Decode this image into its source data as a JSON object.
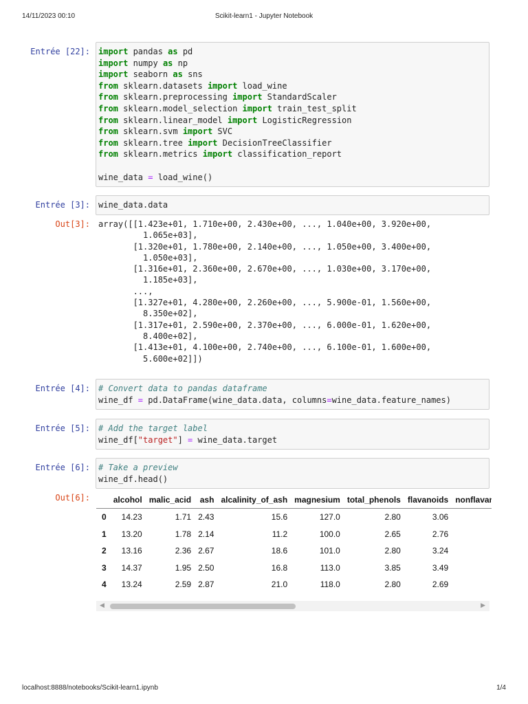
{
  "header": {
    "datetime": "14/11/2023 00:10",
    "title": "Scikit-learn1 - Jupyter Notebook"
  },
  "footer": {
    "url": "localhost:8888/notebooks/Scikit-learn1.ipynb",
    "page": "1/4"
  },
  "cells": [
    {
      "prompt": "Entrée [22]:",
      "lines": [
        [
          [
            "import",
            "kw"
          ],
          [
            " pandas ",
            ""
          ],
          [
            "as",
            "kw"
          ],
          [
            " pd",
            ""
          ]
        ],
        [
          [
            "import",
            "kw"
          ],
          [
            " numpy ",
            ""
          ],
          [
            "as",
            "kw"
          ],
          [
            " np",
            ""
          ]
        ],
        [
          [
            "import",
            "kw"
          ],
          [
            " seaborn ",
            ""
          ],
          [
            "as",
            "kw"
          ],
          [
            " sns",
            ""
          ]
        ],
        [
          [
            "from",
            "kw"
          ],
          [
            " sklearn.datasets ",
            ""
          ],
          [
            "import",
            "kw"
          ],
          [
            " load_wine",
            ""
          ]
        ],
        [
          [
            "from",
            "kw"
          ],
          [
            " sklearn.preprocessing ",
            ""
          ],
          [
            "import",
            "kw"
          ],
          [
            " StandardScaler",
            ""
          ]
        ],
        [
          [
            "from",
            "kw"
          ],
          [
            " sklearn.model_selection ",
            ""
          ],
          [
            "import",
            "kw"
          ],
          [
            " train_test_split",
            ""
          ]
        ],
        [
          [
            "from",
            "kw"
          ],
          [
            " sklearn.linear_model ",
            ""
          ],
          [
            "import",
            "kw"
          ],
          [
            " LogisticRegression",
            ""
          ]
        ],
        [
          [
            "from",
            "kw"
          ],
          [
            " sklearn.svm ",
            ""
          ],
          [
            "import",
            "kw"
          ],
          [
            " SVC",
            ""
          ]
        ],
        [
          [
            "from",
            "kw"
          ],
          [
            " sklearn.tree ",
            ""
          ],
          [
            "import",
            "kw"
          ],
          [
            " DecisionTreeClassifier",
            ""
          ]
        ],
        [
          [
            "from",
            "kw"
          ],
          [
            " sklearn.metrics ",
            ""
          ],
          [
            "import",
            "kw"
          ],
          [
            " classification_report",
            ""
          ]
        ],
        [
          [
            "",
            ""
          ]
        ],
        [
          [
            "wine_data ",
            ""
          ],
          [
            "=",
            "op"
          ],
          [
            " load_wine()",
            ""
          ]
        ]
      ]
    },
    {
      "prompt": "Entrée [3]:",
      "lines": [
        [
          [
            "wine_data.data",
            ""
          ]
        ]
      ]
    },
    {
      "prompt": "Entrée [4]:",
      "lines": [
        [
          [
            "# Convert data to pandas dataframe",
            "cm"
          ]
        ],
        [
          [
            "wine_df ",
            ""
          ],
          [
            "=",
            "op"
          ],
          [
            " pd.DataFrame(wine_data.data, columns",
            ""
          ],
          [
            "=",
            "op"
          ],
          [
            "wine_data.feature_names)",
            ""
          ]
        ]
      ]
    },
    {
      "prompt": "Entrée [5]:",
      "lines": [
        [
          [
            "# Add the target label",
            "cm"
          ]
        ],
        [
          [
            "wine_df[",
            ""
          ],
          [
            "\"target\"",
            "st"
          ],
          [
            "] ",
            ""
          ],
          [
            "=",
            "op"
          ],
          [
            " wine_data.target",
            ""
          ]
        ]
      ]
    },
    {
      "prompt": "Entrée [6]:",
      "lines": [
        [
          [
            "# Take a preview",
            "cm"
          ]
        ],
        [
          [
            "wine_df.head()",
            ""
          ]
        ]
      ]
    }
  ],
  "out3": {
    "prompt": "Out[3]:",
    "text": "array([[1.423e+01, 1.710e+00, 2.430e+00, ..., 1.040e+00, 3.920e+00,\n         1.065e+03],\n       [1.320e+01, 1.780e+00, 2.140e+00, ..., 1.050e+00, 3.400e+00,\n         1.050e+03],\n       [1.316e+01, 2.360e+00, 2.670e+00, ..., 1.030e+00, 3.170e+00,\n         1.185e+03],\n       ...,\n       [1.327e+01, 4.280e+00, 2.260e+00, ..., 5.900e-01, 1.560e+00,\n         8.350e+02],\n       [1.317e+01, 2.590e+00, 2.370e+00, ..., 6.000e-01, 1.620e+00,\n         8.400e+02],\n       [1.413e+01, 4.100e+00, 2.740e+00, ..., 6.100e-01, 1.600e+00,\n         5.600e+02]])"
  },
  "out6": {
    "prompt": "Out[6]:",
    "columns": [
      "",
      "alcohol",
      "malic_acid",
      "ash",
      "alcalinity_of_ash",
      "magnesium",
      "total_phenols",
      "flavanoids",
      "nonflavanoid_phenols"
    ],
    "rows": [
      [
        "0",
        "14.23",
        "1.71",
        "2.43",
        "15.6",
        "127.0",
        "2.80",
        "3.06",
        ""
      ],
      [
        "1",
        "13.20",
        "1.78",
        "2.14",
        "11.2",
        "100.0",
        "2.65",
        "2.76",
        ""
      ],
      [
        "2",
        "13.16",
        "2.36",
        "2.67",
        "18.6",
        "101.0",
        "2.80",
        "3.24",
        ""
      ],
      [
        "3",
        "14.37",
        "1.95",
        "2.50",
        "16.8",
        "113.0",
        "3.85",
        "3.49",
        ""
      ],
      [
        "4",
        "13.24",
        "2.59",
        "2.87",
        "21.0",
        "118.0",
        "2.80",
        "2.69",
        ""
      ]
    ]
  }
}
